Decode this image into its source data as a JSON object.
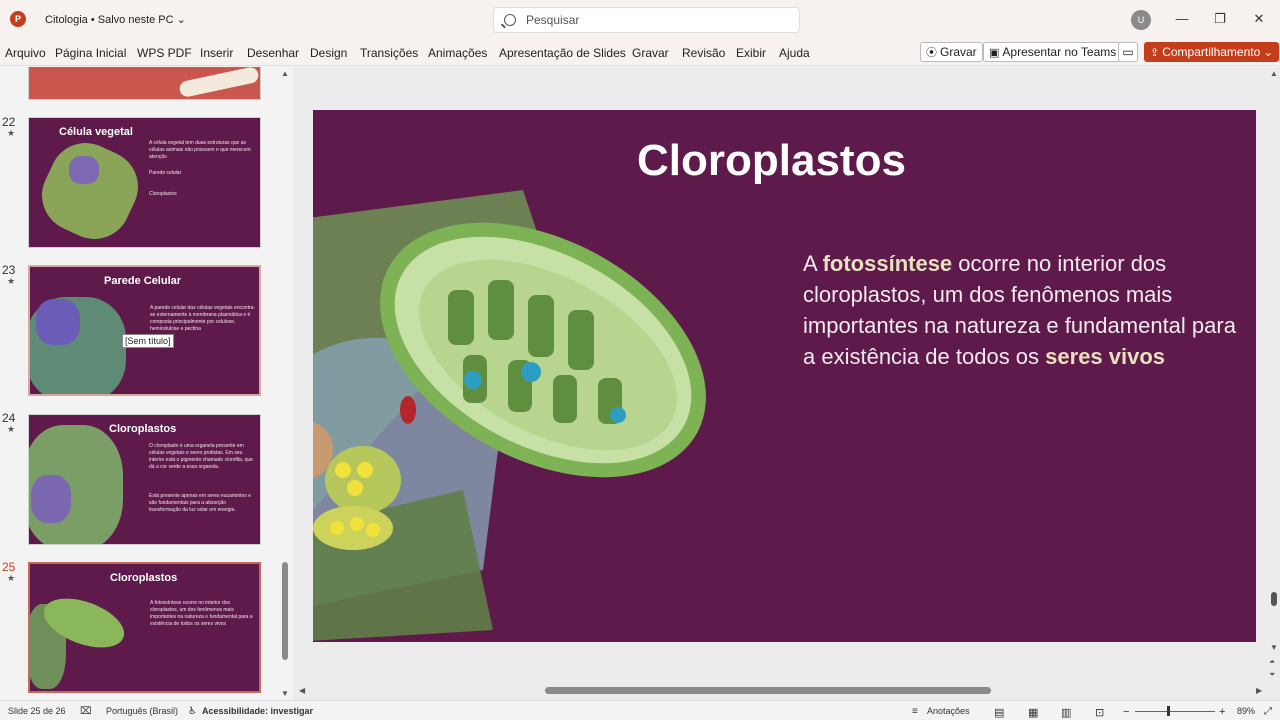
{
  "titlebar": {
    "app_icon_letter": "P",
    "doc_title": "Citologia • Salvo neste PC",
    "search_placeholder": "Pesquisar",
    "user_initial": "U"
  },
  "ribbon": {
    "tabs": [
      "Arquivo",
      "Página Inicial",
      "WPS PDF",
      "Inserir",
      "Desenhar",
      "Design",
      "Transições",
      "Animações",
      "Apresentação de Slides",
      "Gravar",
      "Revisão",
      "Exibir",
      "Ajuda"
    ],
    "record_label": "Gravar",
    "teams_label": "Apresentar no Teams",
    "share_label": "Compartilhamento"
  },
  "thumbnails": [
    {
      "num": "22",
      "title": "Célula vegetal",
      "body": "A célula vegetal tem duas estruturas que as células animais não possuem e que merecem atenção",
      "labels": [
        "Parede celular",
        "Cloroplastos"
      ]
    },
    {
      "num": "23",
      "title": "Parede Celular",
      "body": "A parede celular das células vegetais encontra-se externamente à membrana plasmática e é composta principalmente por celulose, hemicelulose e pectina"
    },
    {
      "num": "24",
      "title": "Cloroplastos",
      "body": "O cloroplasto é uma organela presente em células vegetais e seres protistas. Em seu interior está o pigmento chamado clorofila, que dá a cor verde a essa organela.",
      "body2": "Está presente apenas em seres eucariontes e são fundamentais para a absorção transformação da luz solar em energia."
    },
    {
      "num": "25",
      "title": "Cloroplastos",
      "body": "A fotossíntese ocorre no interior dos cloroplastos, um dos fenômenos mais importantes na natureza e fundamental para a existência de todos os seres vivos"
    }
  ],
  "tooltip": "[Sem título]",
  "slide": {
    "title": "Cloroplastos",
    "body_parts": [
      "A ",
      "fotossíntese",
      " ocorre no interior dos cloroplastos, um dos fenômenos mais importantes na natureza e fundamental para a existência de todos os ",
      "seres vivos"
    ]
  },
  "status": {
    "slide_info": "Slide 25 de 26",
    "language": "Português (Brasil)",
    "accessibility": "Acessibilidade: investigar",
    "notes": "Anotações",
    "zoom": "89%"
  },
  "colors": {
    "slide_bg": "#5e1a4a",
    "accent": "#c43e1c",
    "highlight": "#e8e1bd"
  }
}
